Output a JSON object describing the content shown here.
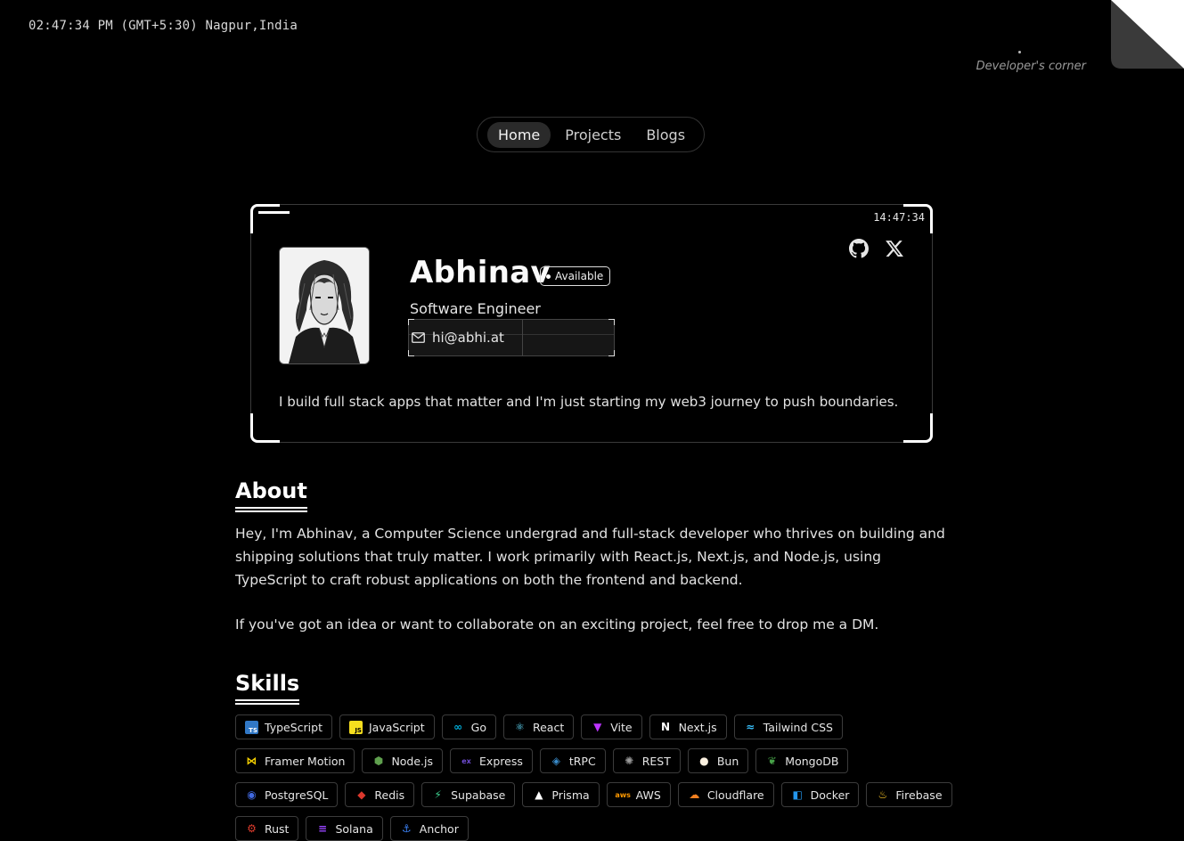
{
  "header": {
    "clock": "02:47:34 PM (GMT+5:30) Nagpur,India",
    "dev_corner": "Developer's corner"
  },
  "nav": {
    "items": [
      {
        "label": "Home",
        "active": true
      },
      {
        "label": "Projects",
        "active": false
      },
      {
        "label": "Blogs",
        "active": false
      }
    ]
  },
  "profile": {
    "clock": "14:47:34",
    "progress": 0.55,
    "name": "Abhinav",
    "status": "Available",
    "role": "Software Engineer",
    "email": "hi@abhi.at",
    "bio": "I build full stack apps that matter and I'm just starting my web3 journey to push boundaries.",
    "social": [
      "github-icon",
      "x-icon"
    ]
  },
  "about": {
    "title": "About",
    "p1": "Hey, I'm Abhinav, a Computer Science undergrad and full-stack developer who thrives on building and shipping solutions that truly matter. I work primarily with React.js, Next.js, and Node.js, using TypeScript to craft robust applications on both the frontend and backend.",
    "p2": "If you've got an idea or want to collaborate on an exciting project, feel free to drop me a DM."
  },
  "skills": {
    "title": "Skills",
    "items": [
      {
        "name": "TypeScript",
        "icon": "typescript-icon",
        "color": "#3178c6"
      },
      {
        "name": "JavaScript",
        "icon": "javascript-icon",
        "color": "#f7df1e"
      },
      {
        "name": "Go",
        "icon": "go-icon",
        "color": "#00add8"
      },
      {
        "name": "React",
        "icon": "react-icon",
        "color": "#61dafb"
      },
      {
        "name": "Vite",
        "icon": "vite-icon",
        "color": "#bd34fe"
      },
      {
        "name": "Next.js",
        "icon": "nextjs-icon",
        "color": "#ffffff"
      },
      {
        "name": "Tailwind CSS",
        "icon": "tailwind-icon",
        "color": "#38bdf8"
      },
      {
        "name": "Framer Motion",
        "icon": "framer-icon",
        "color": "#f5d000"
      },
      {
        "name": "Node.js",
        "icon": "nodejs-icon",
        "color": "#5fa04e"
      },
      {
        "name": "Express",
        "icon": "express-icon",
        "color": "#6f4cd2"
      },
      {
        "name": "tRPC",
        "icon": "trpc-icon",
        "color": "#398ccb"
      },
      {
        "name": "REST",
        "icon": "rest-icon",
        "color": "#9a9a9a"
      },
      {
        "name": "Bun",
        "icon": "bun-icon",
        "color": "#fbf0df"
      },
      {
        "name": "MongoDB",
        "icon": "mongodb-icon",
        "color": "#47a248"
      },
      {
        "name": "PostgreSQL",
        "icon": "postgresql-icon",
        "color": "#4169e1"
      },
      {
        "name": "Redis",
        "icon": "redis-icon",
        "color": "#dc382d"
      },
      {
        "name": "Supabase",
        "icon": "supabase-icon",
        "color": "#3ecf8e"
      },
      {
        "name": "Prisma",
        "icon": "prisma-icon",
        "color": "#ffffff"
      },
      {
        "name": "AWS",
        "icon": "aws-icon",
        "color": "#ff9900"
      },
      {
        "name": "Cloudflare",
        "icon": "cloudflare-icon",
        "color": "#f38020"
      },
      {
        "name": "Docker",
        "icon": "docker-icon",
        "color": "#2496ed"
      },
      {
        "name": "Firebase",
        "icon": "firebase-icon",
        "color": "#ffca28"
      },
      {
        "name": "Rust",
        "icon": "rust-icon",
        "color": "#dc3b2c"
      },
      {
        "name": "Solana",
        "icon": "solana-icon",
        "color": "#9945ff"
      },
      {
        "name": "Anchor",
        "icon": "anchor-icon",
        "color": "#3b82f6"
      }
    ]
  }
}
